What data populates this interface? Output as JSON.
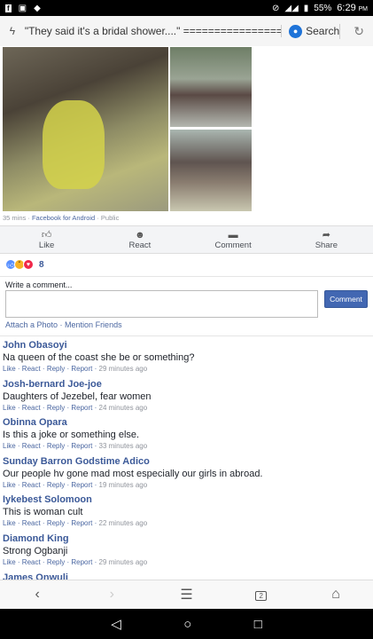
{
  "status": {
    "battery": "55%",
    "time": "6:29",
    "ampm": "PM"
  },
  "address": {
    "url": "\"They said it's a bridal shower....\" ====================",
    "search_label": "Search"
  },
  "post": {
    "meta": {
      "time": "35 mins",
      "source": "Facebook for Android",
      "privacy": "Public"
    },
    "actions": [
      {
        "label": "Like",
        "icon": "thumbs-up-icon"
      },
      {
        "label": "React",
        "icon": "smiley-icon"
      },
      {
        "label": "Comment",
        "icon": "speech-bubble-icon"
      },
      {
        "label": "Share",
        "icon": "share-arrow-icon"
      }
    ],
    "reaction_count": "8"
  },
  "composer": {
    "label": "Write a comment...",
    "button": "Comment",
    "attach": "Attach a Photo",
    "mention": "Mention Friends"
  },
  "comment_actions": {
    "like": "Like",
    "react": "React",
    "reply": "Reply",
    "report": "Report"
  },
  "comments": [
    {
      "name": "John Obasoyi",
      "text": "Na queen of the coast she be or something?",
      "time": "29 minutes ago"
    },
    {
      "name": "Josh-bernard Joe-joe",
      "text": "Daughters of Jezebel, fear women",
      "time": "24 minutes ago"
    },
    {
      "name": "Obinna Opara",
      "text": "Is this a joke or something else.",
      "time": "33 minutes ago"
    },
    {
      "name": "Sunday Barron Godstime Adico",
      "text": "Our people hv gone mad most especially our girls in abroad.",
      "time": "19 minutes ago"
    },
    {
      "name": "Iykebest Solomoon",
      "text": "This is woman cult",
      "time": "22 minutes ago"
    },
    {
      "name": "Diamond King",
      "text": "Strong Ogbanji",
      "time": "29 minutes ago"
    },
    {
      "name": "James Onwuli",
      "text": "",
      "time": ""
    }
  ],
  "browser_nav": {
    "tab_count": "2"
  }
}
